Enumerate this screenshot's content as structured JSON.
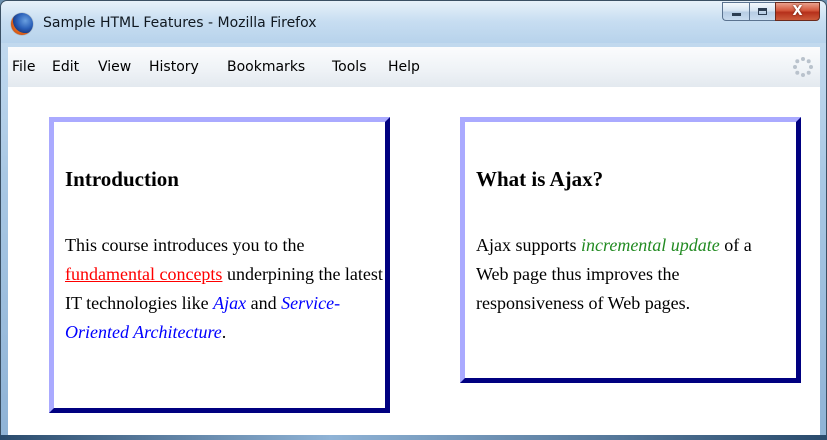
{
  "window": {
    "title": "Sample HTML Features - Mozilla Firefox",
    "controls": {
      "minimize_icon": "minimize-icon",
      "maximize_icon": "maximize-icon",
      "close_label": "X"
    }
  },
  "menubar": {
    "items": [
      {
        "label": "File"
      },
      {
        "label": "Edit"
      },
      {
        "label": "View"
      },
      {
        "label": "History"
      },
      {
        "label": "Bookmarks"
      },
      {
        "label": "Tools"
      },
      {
        "label": "Help"
      }
    ],
    "throbber_icon": "loading-throbber-icon"
  },
  "page": {
    "intro": {
      "heading": "Introduction",
      "text_1": "This course introduces you to the",
      "link": "fundamental concepts",
      "text_2": " underpining the latest IT technologies like ",
      "em_1": "Ajax",
      "text_3": " and ",
      "em_2": "Service-Oriented Architecture",
      "text_4": "."
    },
    "ajax": {
      "heading": "What is Ajax?",
      "text_1": "Ajax supports ",
      "em": "incremental update",
      "text_2": " of a Web page thus improves the responsiveness of Web pages."
    }
  },
  "colors": {
    "border_light": "#aaaaff",
    "border_dark": "#000080",
    "link": "#ff0000",
    "em_blue": "#0000ff",
    "em_green": "#228b22"
  }
}
